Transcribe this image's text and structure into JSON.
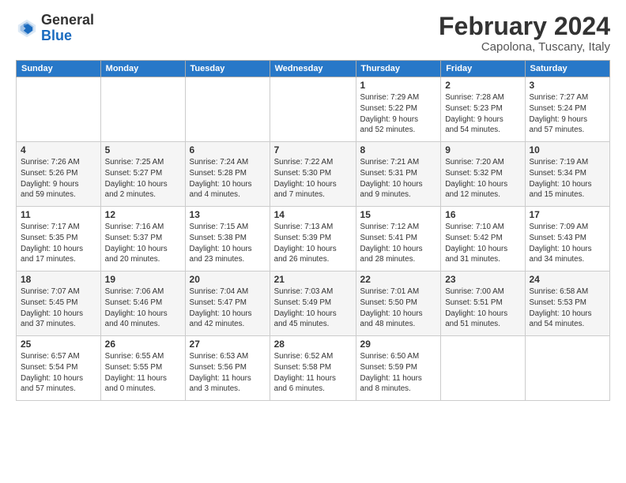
{
  "header": {
    "logo_general": "General",
    "logo_blue": "Blue",
    "month_title": "February 2024",
    "subtitle": "Capolona, Tuscany, Italy"
  },
  "days_of_week": [
    "Sunday",
    "Monday",
    "Tuesday",
    "Wednesday",
    "Thursday",
    "Friday",
    "Saturday"
  ],
  "weeks": [
    [
      {
        "day": "",
        "info": ""
      },
      {
        "day": "",
        "info": ""
      },
      {
        "day": "",
        "info": ""
      },
      {
        "day": "",
        "info": ""
      },
      {
        "day": "1",
        "info": "Sunrise: 7:29 AM\nSunset: 5:22 PM\nDaylight: 9 hours\nand 52 minutes."
      },
      {
        "day": "2",
        "info": "Sunrise: 7:28 AM\nSunset: 5:23 PM\nDaylight: 9 hours\nand 54 minutes."
      },
      {
        "day": "3",
        "info": "Sunrise: 7:27 AM\nSunset: 5:24 PM\nDaylight: 9 hours\nand 57 minutes."
      }
    ],
    [
      {
        "day": "4",
        "info": "Sunrise: 7:26 AM\nSunset: 5:26 PM\nDaylight: 9 hours\nand 59 minutes."
      },
      {
        "day": "5",
        "info": "Sunrise: 7:25 AM\nSunset: 5:27 PM\nDaylight: 10 hours\nand 2 minutes."
      },
      {
        "day": "6",
        "info": "Sunrise: 7:24 AM\nSunset: 5:28 PM\nDaylight: 10 hours\nand 4 minutes."
      },
      {
        "day": "7",
        "info": "Sunrise: 7:22 AM\nSunset: 5:30 PM\nDaylight: 10 hours\nand 7 minutes."
      },
      {
        "day": "8",
        "info": "Sunrise: 7:21 AM\nSunset: 5:31 PM\nDaylight: 10 hours\nand 9 minutes."
      },
      {
        "day": "9",
        "info": "Sunrise: 7:20 AM\nSunset: 5:32 PM\nDaylight: 10 hours\nand 12 minutes."
      },
      {
        "day": "10",
        "info": "Sunrise: 7:19 AM\nSunset: 5:34 PM\nDaylight: 10 hours\nand 15 minutes."
      }
    ],
    [
      {
        "day": "11",
        "info": "Sunrise: 7:17 AM\nSunset: 5:35 PM\nDaylight: 10 hours\nand 17 minutes."
      },
      {
        "day": "12",
        "info": "Sunrise: 7:16 AM\nSunset: 5:37 PM\nDaylight: 10 hours\nand 20 minutes."
      },
      {
        "day": "13",
        "info": "Sunrise: 7:15 AM\nSunset: 5:38 PM\nDaylight: 10 hours\nand 23 minutes."
      },
      {
        "day": "14",
        "info": "Sunrise: 7:13 AM\nSunset: 5:39 PM\nDaylight: 10 hours\nand 26 minutes."
      },
      {
        "day": "15",
        "info": "Sunrise: 7:12 AM\nSunset: 5:41 PM\nDaylight: 10 hours\nand 28 minutes."
      },
      {
        "day": "16",
        "info": "Sunrise: 7:10 AM\nSunset: 5:42 PM\nDaylight: 10 hours\nand 31 minutes."
      },
      {
        "day": "17",
        "info": "Sunrise: 7:09 AM\nSunset: 5:43 PM\nDaylight: 10 hours\nand 34 minutes."
      }
    ],
    [
      {
        "day": "18",
        "info": "Sunrise: 7:07 AM\nSunset: 5:45 PM\nDaylight: 10 hours\nand 37 minutes."
      },
      {
        "day": "19",
        "info": "Sunrise: 7:06 AM\nSunset: 5:46 PM\nDaylight: 10 hours\nand 40 minutes."
      },
      {
        "day": "20",
        "info": "Sunrise: 7:04 AM\nSunset: 5:47 PM\nDaylight: 10 hours\nand 42 minutes."
      },
      {
        "day": "21",
        "info": "Sunrise: 7:03 AM\nSunset: 5:49 PM\nDaylight: 10 hours\nand 45 minutes."
      },
      {
        "day": "22",
        "info": "Sunrise: 7:01 AM\nSunset: 5:50 PM\nDaylight: 10 hours\nand 48 minutes."
      },
      {
        "day": "23",
        "info": "Sunrise: 7:00 AM\nSunset: 5:51 PM\nDaylight: 10 hours\nand 51 minutes."
      },
      {
        "day": "24",
        "info": "Sunrise: 6:58 AM\nSunset: 5:53 PM\nDaylight: 10 hours\nand 54 minutes."
      }
    ],
    [
      {
        "day": "25",
        "info": "Sunrise: 6:57 AM\nSunset: 5:54 PM\nDaylight: 10 hours\nand 57 minutes."
      },
      {
        "day": "26",
        "info": "Sunrise: 6:55 AM\nSunset: 5:55 PM\nDaylight: 11 hours\nand 0 minutes."
      },
      {
        "day": "27",
        "info": "Sunrise: 6:53 AM\nSunset: 5:56 PM\nDaylight: 11 hours\nand 3 minutes."
      },
      {
        "day": "28",
        "info": "Sunrise: 6:52 AM\nSunset: 5:58 PM\nDaylight: 11 hours\nand 6 minutes."
      },
      {
        "day": "29",
        "info": "Sunrise: 6:50 AM\nSunset: 5:59 PM\nDaylight: 11 hours\nand 8 minutes."
      },
      {
        "day": "",
        "info": ""
      },
      {
        "day": "",
        "info": ""
      }
    ]
  ]
}
